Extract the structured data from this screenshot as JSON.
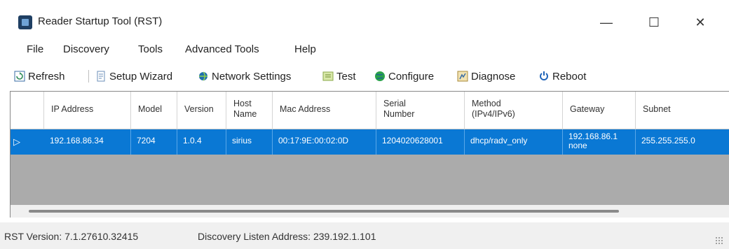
{
  "window": {
    "title": "Reader Startup Tool (RST)",
    "minimize_glyph": "—",
    "maximize_glyph": "☐",
    "close_glyph": "✕"
  },
  "menu": [
    "File",
    "Discovery",
    "Tools",
    "Advanced Tools",
    "Help"
  ],
  "toolbar": [
    {
      "label": "Refresh",
      "icon": "refresh-icon"
    },
    {
      "label": "Setup Wizard",
      "icon": "wizard-icon"
    },
    {
      "label": "Network Settings",
      "icon": "network-icon"
    },
    {
      "label": "Test",
      "icon": "test-icon"
    },
    {
      "label": "Configure",
      "icon": "globe-icon"
    },
    {
      "label": "Diagnose",
      "icon": "diagnose-icon"
    },
    {
      "label": "Reboot",
      "icon": "reboot-icon"
    }
  ],
  "table": {
    "columns": [
      "IP Address",
      "Model",
      "Version",
      "Host\nName",
      "Mac Address",
      "Serial\nNumber",
      "Method\n(IPv4/IPv6)",
      "Gateway",
      "Subnet"
    ],
    "row_indicator": "▷",
    "rows": [
      [
        "192.168.86.34",
        "7204",
        "1.0.4",
        "sirius",
        "00:17:9E:00:02:0D",
        "1204020628001",
        "dhcp/radv_only",
        "192.168.86.1\nnone",
        "255.255.255.0"
      ]
    ]
  },
  "status": {
    "version": "RST Version: 7.1.27610.32415",
    "listen": "Discovery Listen Address: 239.192.1.101"
  },
  "colors": {
    "selection": "#0a78d4",
    "empty_grid": "#ababab"
  }
}
